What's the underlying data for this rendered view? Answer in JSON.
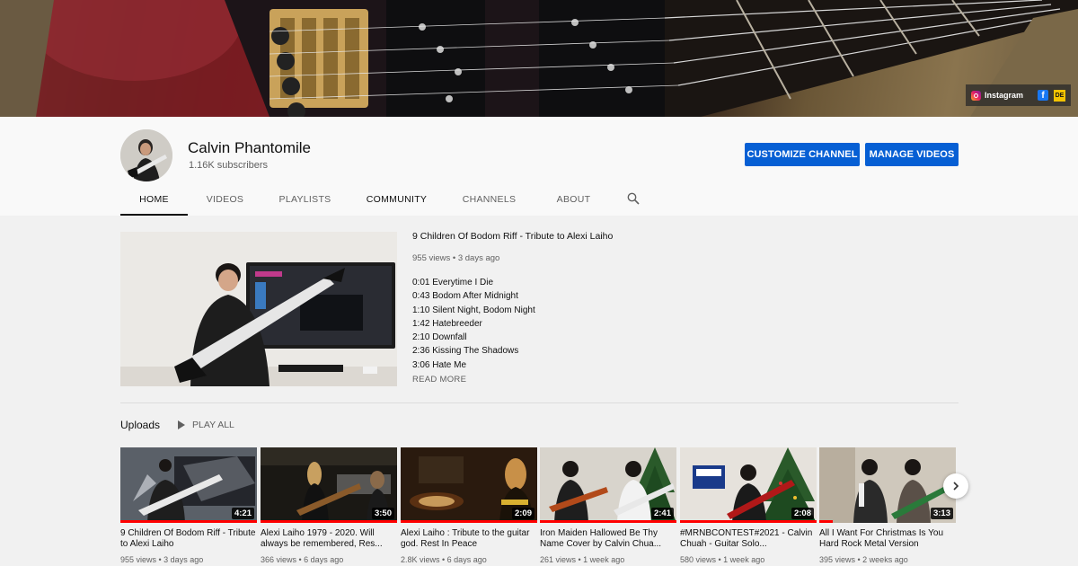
{
  "banner": {
    "links": [
      {
        "icon": "instagram-icon",
        "label": "Instagram"
      },
      {
        "icon": "facebook-icon",
        "label": ""
      },
      {
        "icon": "de-icon",
        "label": "DE"
      }
    ]
  },
  "channel": {
    "name": "Calvin Phantomile",
    "subscribers": "1.16K subscribers",
    "customize_label": "CUSTOMIZE CHANNEL",
    "manage_label": "MANAGE VIDEOS",
    "accent": "#065fd4"
  },
  "tabs": [
    "HOME",
    "VIDEOS",
    "PLAYLISTS",
    "COMMUNITY",
    "CHANNELS",
    "ABOUT"
  ],
  "featured": {
    "title": "9 Children Of Bodom Riff - Tribute to Alexi Laiho",
    "meta": "955 views • 3 days ago",
    "description": [
      "0:01 Everytime I Die",
      "0:43 Bodom After Midnight",
      "1:10 Silent Night, Bodom Night",
      "1:42 Hatebreeder",
      "2:10 Downfall",
      "2:36 Kissing The Shadows",
      "3:06 Hate Me"
    ],
    "read_more": "READ MORE"
  },
  "uploads": {
    "title": "Uploads",
    "play_all": "PLAY ALL",
    "videos": [
      {
        "title": "9 Children Of Bodom Riff - Tribute to Alexi Laiho",
        "meta": "955 views • 3 days ago",
        "duration": "4:21",
        "watched": 1.0
      },
      {
        "title": "Alexi Laiho 1979 - 2020. Will always be remembered, Res...",
        "meta": "366 views • 6 days ago",
        "duration": "3:50",
        "watched": 1.0
      },
      {
        "title": "Alexi Laiho : Tribute to the guitar god. Rest In Peace",
        "meta": "2.8K views • 6 days ago",
        "duration": "2:09",
        "watched": 1.0
      },
      {
        "title": "Iron Maiden Hallowed Be Thy Name Cover by Calvin Chua...",
        "meta": "261 views • 1 week ago",
        "duration": "2:41",
        "watched": 1.0
      },
      {
        "title": "#MRNBCONTEST#2021 - Calvin Chuah - Guitar Solo...",
        "meta": "580 views • 1 week ago",
        "duration": "2:08",
        "watched": 1.0
      },
      {
        "title": "All I Want For Christmas Is You Hard Rock Metal Version",
        "meta": "395 views • 2 weeks ago",
        "duration": "3:13",
        "watched": 0.1
      }
    ]
  }
}
